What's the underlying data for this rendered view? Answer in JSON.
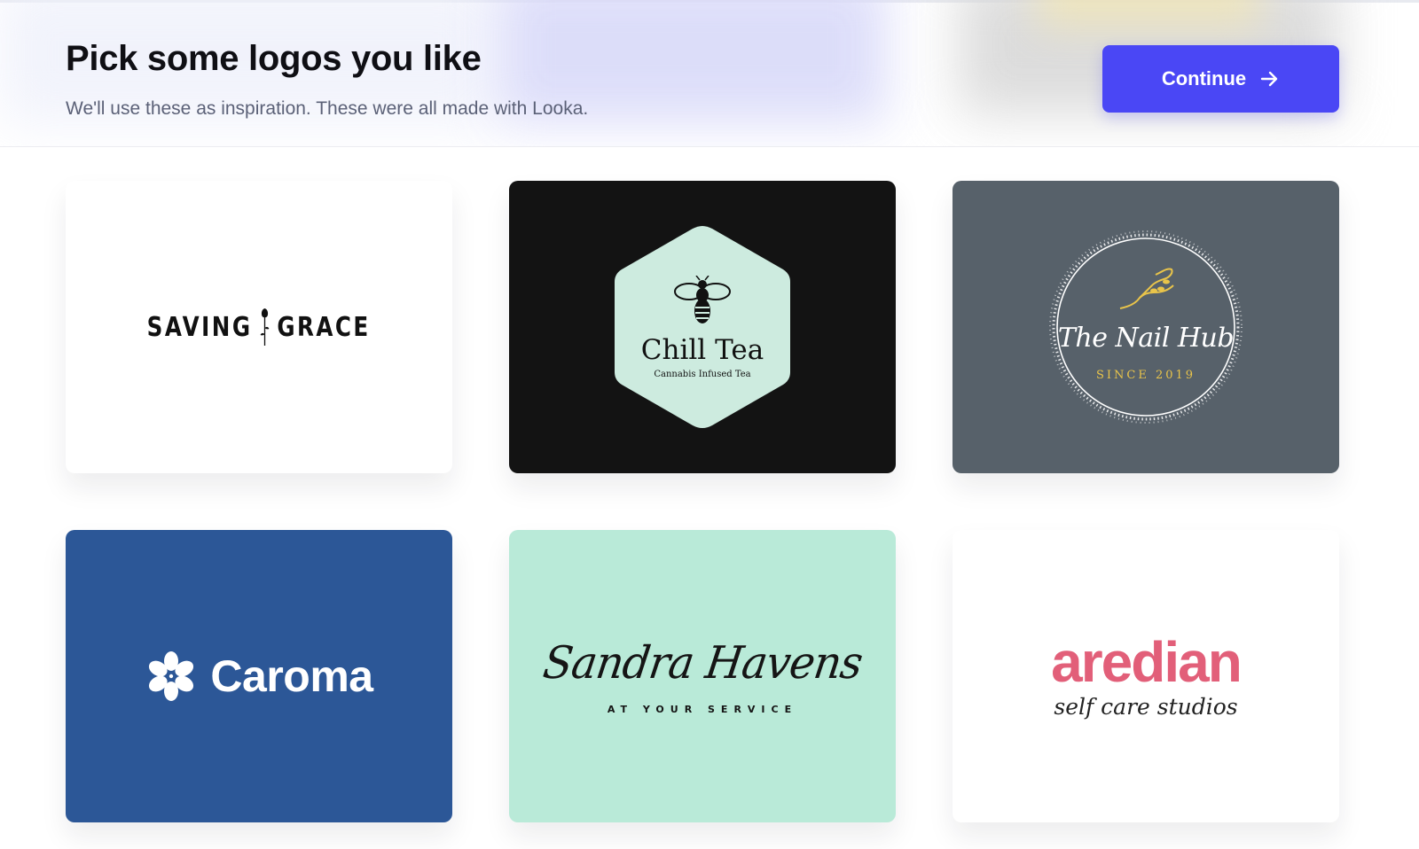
{
  "header": {
    "title": "Pick some logos you like",
    "subtitle": "We'll use these as inspiration. These were all made with Looka.",
    "continue_label": "Continue"
  },
  "logos": [
    {
      "name": "SAVING GRACE",
      "background": "#ffffff"
    },
    {
      "name": "Chill Tea",
      "tagline": "Cannabis Infused Tea",
      "background": "#131313",
      "badge_color": "#cdebdf"
    },
    {
      "name": "The Nail Hub",
      "tagline": "SINCE 2019",
      "background": "#57616a",
      "accent": "#e9c44a"
    },
    {
      "name": "Caroma",
      "background": "#2c5797"
    },
    {
      "name": "Sandra Havens",
      "tagline": "AT YOUR SERVICE",
      "background": "#b9ead8"
    },
    {
      "name": "aredian",
      "tagline": "self care studios",
      "background": "#ffffff",
      "accent": "#e25f79"
    }
  ],
  "colors": {
    "primary_button": "#4a47f5"
  }
}
